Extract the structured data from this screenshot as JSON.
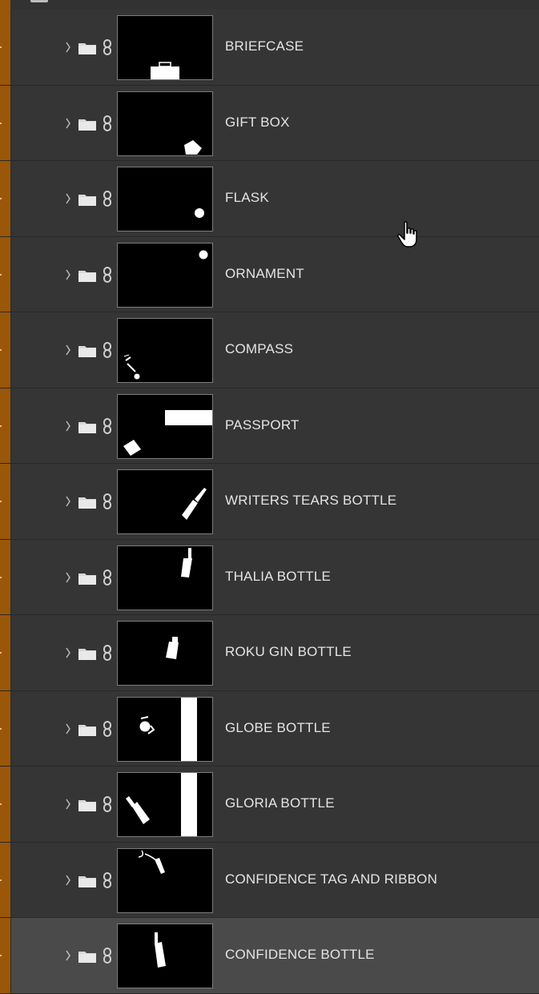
{
  "panel": "layers",
  "layers": [
    {
      "name": "BRIEFCASE",
      "mask_icon": "mask-briefcase"
    },
    {
      "name": "GIFT BOX",
      "mask_icon": "mask-gift-box"
    },
    {
      "name": "FLASK",
      "mask_icon": "mask-flask"
    },
    {
      "name": "ORNAMENT",
      "mask_icon": "mask-ornament"
    },
    {
      "name": "COMPASS",
      "mask_icon": "mask-compass"
    },
    {
      "name": "PASSPORT",
      "mask_icon": "mask-passport"
    },
    {
      "name": "WRITERS TEARS BOTTLE",
      "mask_icon": "mask-writers-tears"
    },
    {
      "name": "THALIA BOTTLE",
      "mask_icon": "mask-thalia"
    },
    {
      "name": "ROKU GIN BOTTLE",
      "mask_icon": "mask-roku"
    },
    {
      "name": "GLOBE BOTTLE",
      "mask_icon": "mask-globe"
    },
    {
      "name": "GLORIA BOTTLE",
      "mask_icon": "mask-gloria"
    },
    {
      "name": "CONFIDENCE TAG AND RIBBON",
      "mask_icon": "mask-confidence-tag"
    },
    {
      "name": "CONFIDENCE BOTTLE",
      "mask_icon": "mask-confidence-bottle",
      "selected": true
    }
  ],
  "colors": {
    "panel_bg": "#353535",
    "selected_bg": "#4a4a4a",
    "group_color_tag": "#9a5709",
    "text": "#e4e4e4"
  },
  "icons": {
    "expand": "chevron-right-icon",
    "group": "folder-icon",
    "link": "link-icon",
    "cursor": "hand-pointer-icon"
  }
}
